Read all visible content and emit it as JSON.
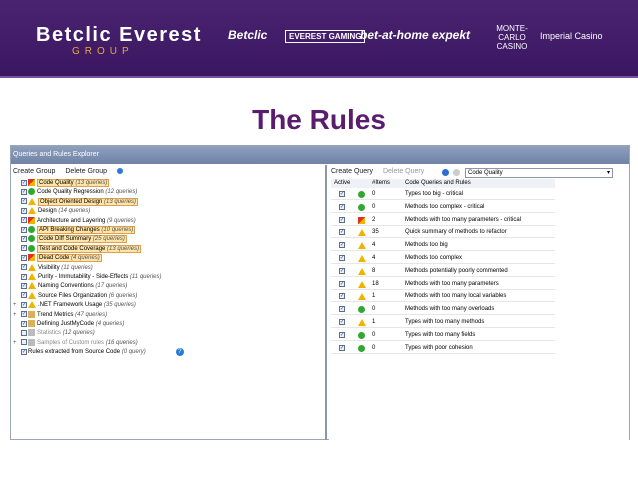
{
  "banner": {
    "logo": "Betclic Everest",
    "logo_sub": "GROUP",
    "brands": [
      "Betclic",
      "EVEREST GAMING",
      "bet-at-home",
      "expekt",
      "MONTE-CARLO CASINO",
      "Imperial Casino"
    ]
  },
  "slide_title": "The Rules",
  "window": {
    "title": "Queries and Rules Explorer",
    "left_toolbar": {
      "create_group": "Create Group",
      "delete_group": "Delete Group"
    },
    "tree": [
      {
        "label": "Code Quality",
        "count": "(13 queries)",
        "icon": "critical-icon",
        "highlight": true
      },
      {
        "label": "Code Quality Regression",
        "count": "(12 queries)",
        "icon": "ok-icon"
      },
      {
        "label": "Object Oriented Design",
        "count": "(13 queries)",
        "icon": "warning-icon",
        "highlight": true
      },
      {
        "label": "Design",
        "count": "(14 queries)",
        "icon": "warning-icon"
      },
      {
        "label": "Architecture and Layering",
        "count": "(9 queries)",
        "icon": "critical-icon"
      },
      {
        "label": "API Breaking Changes",
        "count": "(10 queries)",
        "icon": "ok-icon",
        "highlight": true
      },
      {
        "label": "Code Diff Summary",
        "count": "(25 queries)",
        "icon": "ok-icon",
        "highlight": true
      },
      {
        "label": "Test and Code Coverage",
        "count": "(13 queries)",
        "icon": "ok-icon",
        "highlight": true
      },
      {
        "label": "Dead Code",
        "count": "(4 queries)",
        "icon": "critical-icon",
        "highlight": true
      },
      {
        "label": "Visibility",
        "count": "(11 queries)",
        "icon": "warning-icon"
      },
      {
        "label": "Purity - Immutability - Side-Effects",
        "count": "(11 queries)",
        "icon": "warning-icon"
      },
      {
        "label": "Naming Conventions",
        "count": "(17 queries)",
        "icon": "warning-icon"
      },
      {
        "label": "Source Files Organization",
        "count": "(6 queries)",
        "icon": "warning-icon"
      },
      {
        "label": ".NET Framework Usage",
        "count": "(35 queries)",
        "icon": "warning-icon",
        "expand": "+"
      },
      {
        "label": "Trend Metrics",
        "count": "(47 queries)",
        "icon": "chart-icon",
        "expand": "+"
      },
      {
        "label": "Defining JustMyCode",
        "count": "(4 queries)",
        "icon": "folder-icon"
      },
      {
        "label": "Statistics",
        "count": "(12 queries)",
        "icon": "blank-icon",
        "muted": true
      },
      {
        "label": "Samples of Custom rules",
        "count": "(16 queries)",
        "icon": "blank-icon",
        "muted": true,
        "expand": "+"
      },
      {
        "label": "Rules extracted from Source Code",
        "count": "(0 query)",
        "icon": "none"
      }
    ],
    "right_toolbar": {
      "create_query": "Create Query",
      "delete_query": "Delete Query",
      "group_select": "Code Quality"
    },
    "columns": {
      "active": "Active",
      "items": "#Items",
      "name": "Code Queries and Rules"
    },
    "queries": [
      {
        "items": "0",
        "name": "Types too big - critical",
        "icon": "ok-icon"
      },
      {
        "items": "0",
        "name": "Methods too complex - critical",
        "icon": "ok-icon"
      },
      {
        "items": "2",
        "name": "Methods with too many parameters - critical",
        "icon": "critical-icon"
      },
      {
        "items": "35",
        "name": "Quick summary of methods to refactor",
        "icon": "warning-icon"
      },
      {
        "items": "4",
        "name": "Methods too big",
        "icon": "warning-icon"
      },
      {
        "items": "4",
        "name": "Methods too complex",
        "icon": "warning-icon"
      },
      {
        "items": "8",
        "name": "Methods potentially poorly commented",
        "icon": "warning-icon"
      },
      {
        "items": "18",
        "name": "Methods with too many parameters",
        "icon": "warning-icon"
      },
      {
        "items": "1",
        "name": "Methods with too many local variables",
        "icon": "warning-icon"
      },
      {
        "items": "0",
        "name": "Methods with too many overloads",
        "icon": "ok-icon"
      },
      {
        "items": "1",
        "name": "Types with too many methods",
        "icon": "warning-icon"
      },
      {
        "items": "0",
        "name": "Types with too many fields",
        "icon": "ok-icon"
      },
      {
        "items": "0",
        "name": "Types with poor cohesion",
        "icon": "ok-icon"
      }
    ]
  }
}
